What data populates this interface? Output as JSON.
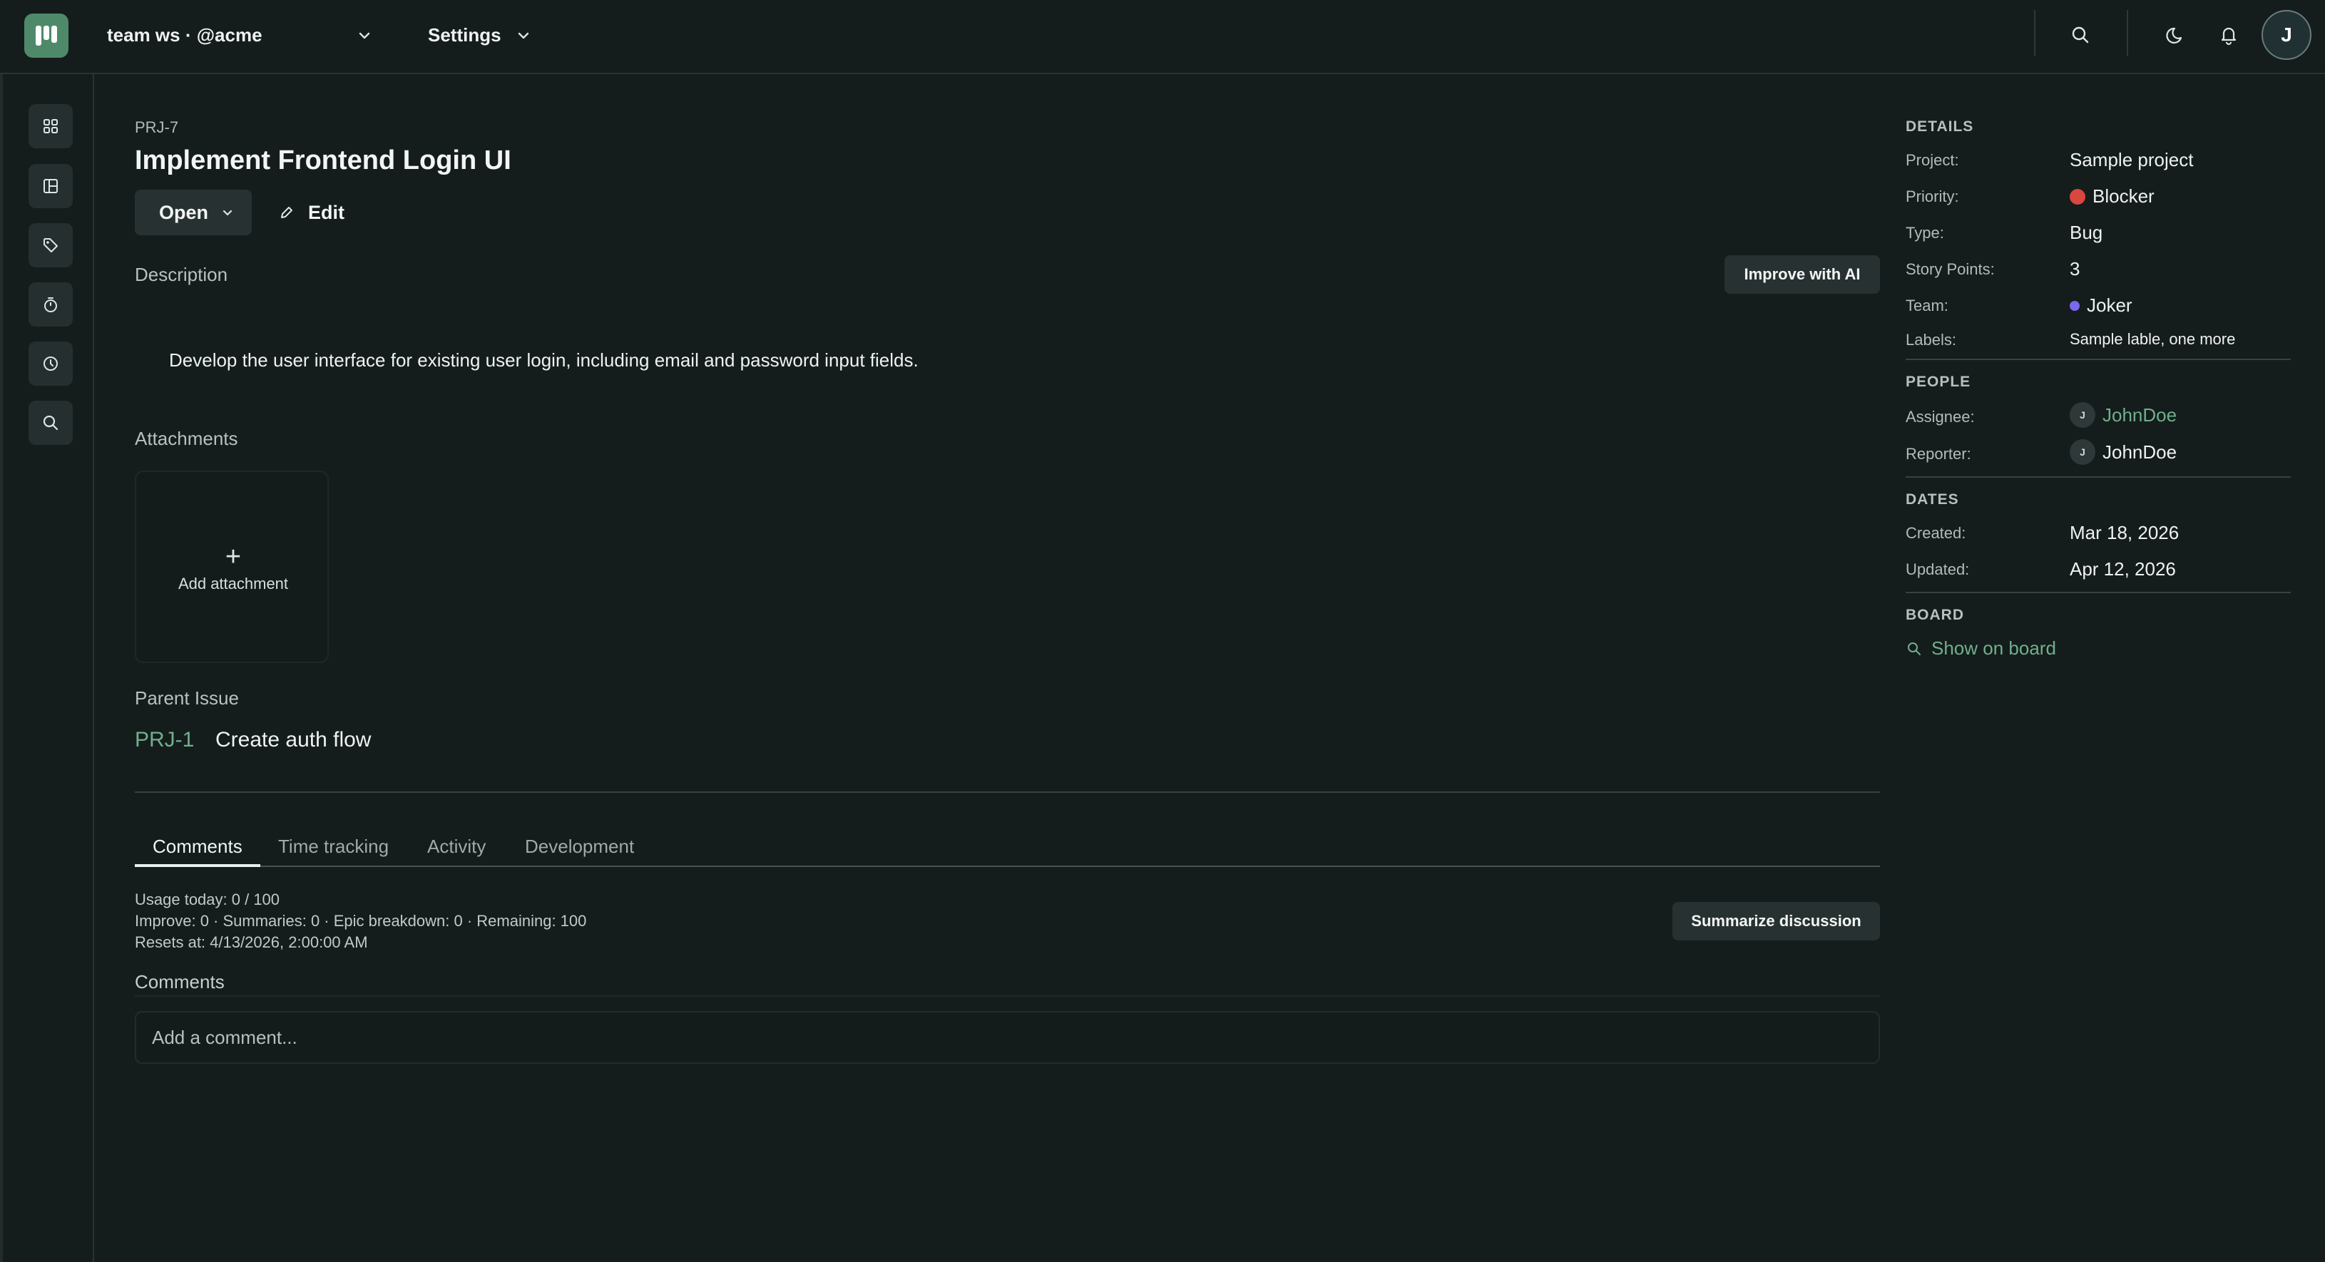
{
  "topbar": {
    "workspace": "team ws · @acme",
    "settings": "Settings",
    "avatar_initial": "J",
    "icons": [
      "search-icon",
      "moon-icon",
      "bell-icon"
    ]
  },
  "sidebar": {
    "items": [
      "dashboard-icon",
      "board-icon",
      "tag-icon",
      "timer-icon",
      "clock-icon",
      "search-icon"
    ]
  },
  "issue": {
    "key": "PRJ-7",
    "title": "Implement Frontend Login UI",
    "status": "Open",
    "edit_label": "Edit",
    "description_label": "Description",
    "improve_label": "Improve with AI",
    "description": "Develop the user interface for existing user login, including email and password input fields.",
    "attachments_label": "Attachments",
    "add_attachment": "Add attachment",
    "add_symbol": "+",
    "parent_label": "Parent Issue",
    "parent_key": "PRJ-1",
    "parent_title": "Create auth flow"
  },
  "tabs": [
    "Comments",
    "Time tracking",
    "Activity",
    "Development"
  ],
  "usage": {
    "line1": "Usage today: 0 / 100",
    "line2": "Improve: 0 · Summaries: 0 · Epic breakdown: 0 · Remaining: 100",
    "line3": "Resets at: 4/13/2026, 2:00:00 AM",
    "summarize_label": "Summarize discussion"
  },
  "comments": {
    "label": "Comments",
    "placeholder": "Add a comment..."
  },
  "details": {
    "heading": "DETAILS",
    "project_label": "Project:",
    "project": "Sample project",
    "priority_label": "Priority:",
    "priority": "Blocker",
    "priority_color": "#d9473f",
    "type_label": "Type:",
    "type": "Bug",
    "points_label": "Story Points:",
    "points": "3",
    "team_label": "Team:",
    "team": "Joker",
    "team_color": "#7b68ee",
    "labels_label": "Labels:",
    "labels": "Sample lable, one more"
  },
  "people": {
    "heading": "PEOPLE",
    "assignee_label": "Assignee:",
    "assignee": "JohnDoe",
    "assignee_initial": "J",
    "reporter_label": "Reporter:",
    "reporter": "JohnDoe",
    "reporter_initial": "J"
  },
  "dates": {
    "heading": "DATES",
    "created_label": "Created:",
    "created": "Mar 18, 2026",
    "updated_label": "Updated:",
    "updated": "Apr 12, 2026"
  },
  "board": {
    "heading": "BOARD",
    "show_label": "Show on board"
  }
}
